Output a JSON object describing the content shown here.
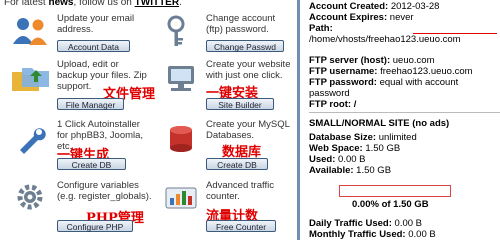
{
  "header": {
    "prefix": "For latest ",
    "news": "news",
    "middle": ", follow us on ",
    "twitter": "TWITTER",
    "suffix": "."
  },
  "tools": [
    {
      "desc": "Update your email address.",
      "button": "Account Data",
      "cn": "",
      "icon": "people-icon"
    },
    {
      "desc": "Change account (ftp) password.",
      "button": "Change Passwd",
      "cn": "",
      "icon": "key-icon"
    },
    {
      "desc": "Upload, edit or backup your files. Zip support.",
      "button": "File Manager",
      "cn": "文件管理",
      "icon": "folders-icon"
    },
    {
      "desc": "Create your website with just one click.",
      "button": "Site Builder",
      "cn": "一键安装",
      "icon": "computer-icon"
    },
    {
      "desc": "1 Click Autoinstaller for phpBB3, Joomla, etc.",
      "button": "Create DB",
      "cn": "一键生成",
      "icon": "wrench-icon"
    },
    {
      "desc": "Create your MySQL Databases.",
      "button": "Create DB",
      "cn": "数据库",
      "icon": "database-icon"
    },
    {
      "desc": "Configure variables (e.g. register_globals).",
      "button": "Configure PHP",
      "cn": "PHP管理",
      "icon": "gear-icon"
    },
    {
      "desc": "Advanced traffic counter.",
      "button": "Free Counter",
      "cn": "流量计数",
      "icon": "counter-icon"
    }
  ],
  "account": {
    "created_label": "Account Created:",
    "created_value": "2012-03-28",
    "expires_label": "Account Expires:",
    "expires_value": "never",
    "path_label": "Path:",
    "path_value": "/home/vhosts/freehao123.ueuo.com",
    "ftp_server_label": "FTP server (host):",
    "ftp_server_value": "ueuo.com",
    "ftp_user_label": "FTP username:",
    "ftp_user_value": "freehao123.ueuo.com",
    "ftp_pass_label": "FTP password:",
    "ftp_pass_value": "equal with account",
    "ftp_pass_value2": "password",
    "ftp_root_label": "FTP root:",
    "ftp_root_value": "/"
  },
  "site": {
    "title": "SMALL/NORMAL SITE (no ads)",
    "db_label": "Database Size:",
    "db_value": "unlimited",
    "ws_label": "Web Space:",
    "ws_value": "1.50 GB",
    "used_label": "Used:",
    "used_value": "0.00 B",
    "avail_label": "Available:",
    "avail_value": "1.50 GB",
    "usage_text": "0.00% of 1.50 GB",
    "usage_fraction": 0.0,
    "daily_label": "Daily Traffic Used:",
    "daily_value": "0.00 B",
    "monthly_label": "Monthly Traffic Used:",
    "monthly_value": "0.00 B"
  }
}
